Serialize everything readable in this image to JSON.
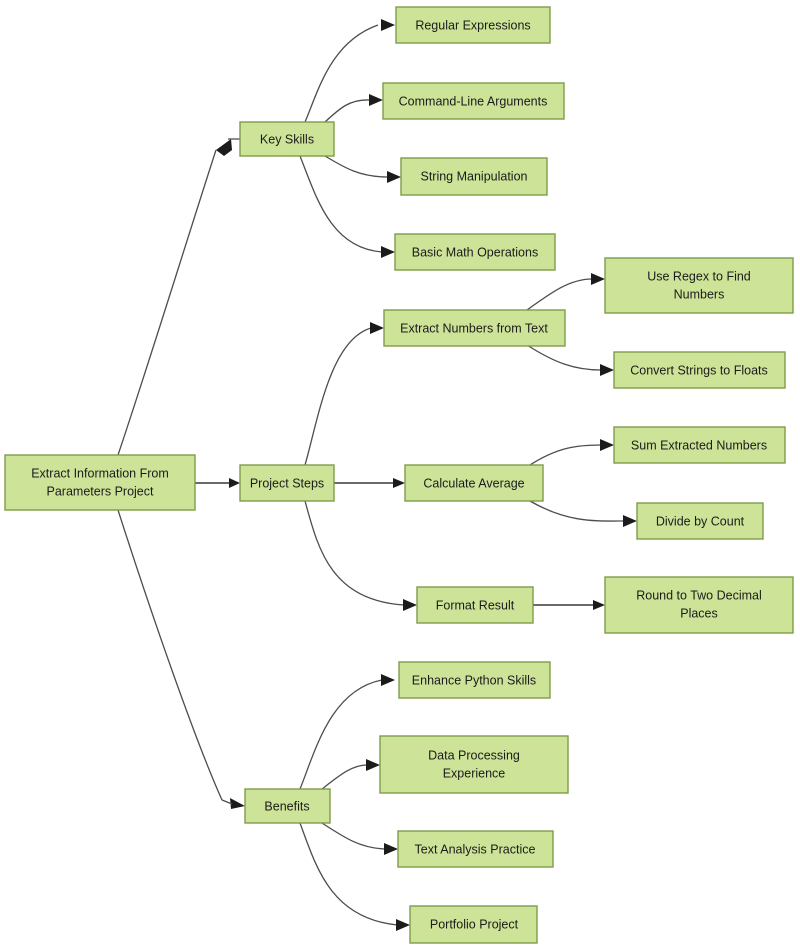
{
  "diagram": {
    "type": "mind-map",
    "title": "Extract Information From Parameters Project",
    "colors": {
      "node_fill": "#cde498",
      "node_stroke": "#7d9c4a",
      "edge_stroke": "#4d4d4d",
      "text": "#1b1b1b",
      "background": "#ffffff"
    },
    "root": {
      "id": "root",
      "label": "Extract Information From Parameters Project",
      "line1": "Extract Information From",
      "line2": "Parameters Project"
    },
    "branches": [
      {
        "id": "key-skills",
        "label": "Key Skills",
        "children": [
          {
            "id": "regular-expressions",
            "label": "Regular Expressions"
          },
          {
            "id": "command-line-arguments",
            "label": "Command-Line Arguments"
          },
          {
            "id": "string-manipulation",
            "label": "String Manipulation"
          },
          {
            "id": "basic-math-operations",
            "label": "Basic Math Operations"
          }
        ]
      },
      {
        "id": "project-steps",
        "label": "Project Steps",
        "children": [
          {
            "id": "extract-numbers-from-text",
            "label": "Extract Numbers from Text",
            "children": [
              {
                "id": "use-regex-to-find-numbers",
                "label": "Use Regex to Find Numbers",
                "line1": "Use Regex to Find",
                "line2": "Numbers"
              },
              {
                "id": "convert-strings-to-floats",
                "label": "Convert Strings to Floats"
              }
            ]
          },
          {
            "id": "calculate-average",
            "label": "Calculate Average",
            "children": [
              {
                "id": "sum-extracted-numbers",
                "label": "Sum Extracted Numbers"
              },
              {
                "id": "divide-by-count",
                "label": "Divide by Count"
              }
            ]
          },
          {
            "id": "format-result",
            "label": "Format Result",
            "children": [
              {
                "id": "round-to-two-decimal-places",
                "label": "Round to Two Decimal Places",
                "line1": "Round to Two Decimal",
                "line2": "Places"
              }
            ]
          }
        ]
      },
      {
        "id": "benefits",
        "label": "Benefits",
        "children": [
          {
            "id": "enhance-python-skills",
            "label": "Enhance Python Skills"
          },
          {
            "id": "data-processing-experience",
            "label": "Data Processing Experience",
            "line1": "Data Processing",
            "line2": "Experience"
          },
          {
            "id": "text-analysis-practice",
            "label": "Text Analysis Practice"
          },
          {
            "id": "portfolio-project",
            "label": "Portfolio Project"
          }
        ]
      }
    ]
  }
}
